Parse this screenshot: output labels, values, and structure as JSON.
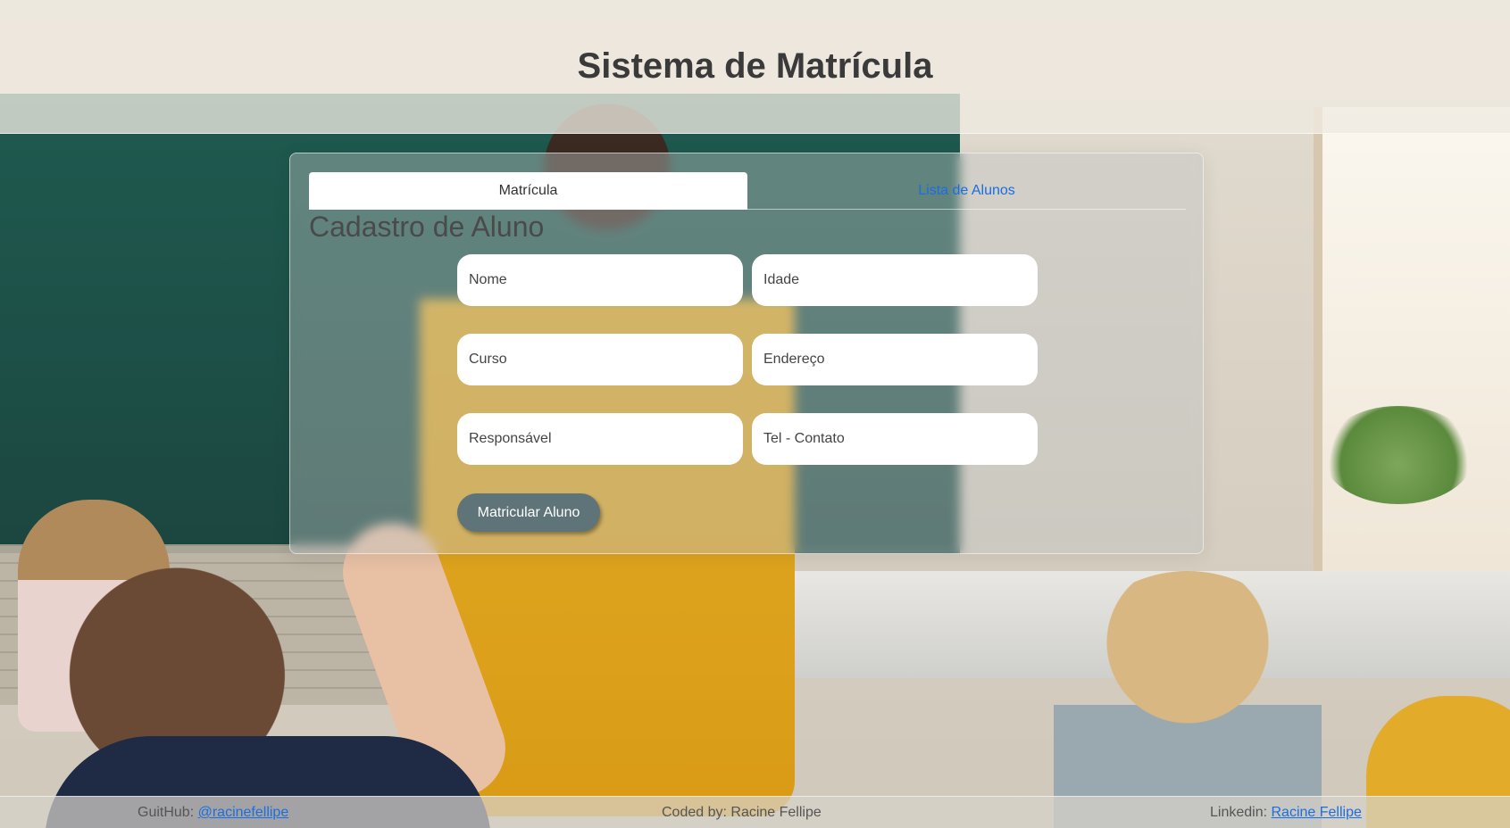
{
  "header": {
    "title": "Sistema de Matrícula"
  },
  "tabs": [
    {
      "label": "Matrícula",
      "active": true
    },
    {
      "label": "Lista de Alunos",
      "active": false
    }
  ],
  "form": {
    "title": "Cadastro de Aluno",
    "fields": {
      "nome": {
        "placeholder": "Nome",
        "value": ""
      },
      "idade": {
        "placeholder": "Idade",
        "value": ""
      },
      "curso": {
        "placeholder": "Curso",
        "value": ""
      },
      "endereco": {
        "placeholder": "Endereço",
        "value": ""
      },
      "responsavel": {
        "placeholder": "Responsável",
        "value": ""
      },
      "contato": {
        "placeholder": "Tel - Contato",
        "value": ""
      }
    },
    "submit_label": "Matricular Aluno"
  },
  "footer": {
    "github_label": "GuitHub:",
    "github_link": "@racinefellipe",
    "coded_by": "Coded by: Racine Fellipe",
    "linkedin_label": "Linkedin:",
    "linkedin_link": "Racine Fellipe"
  },
  "colors": {
    "accent_link": "#1a6ee0",
    "button": "#5f7478",
    "tab_active_bg": "#ffffff"
  }
}
